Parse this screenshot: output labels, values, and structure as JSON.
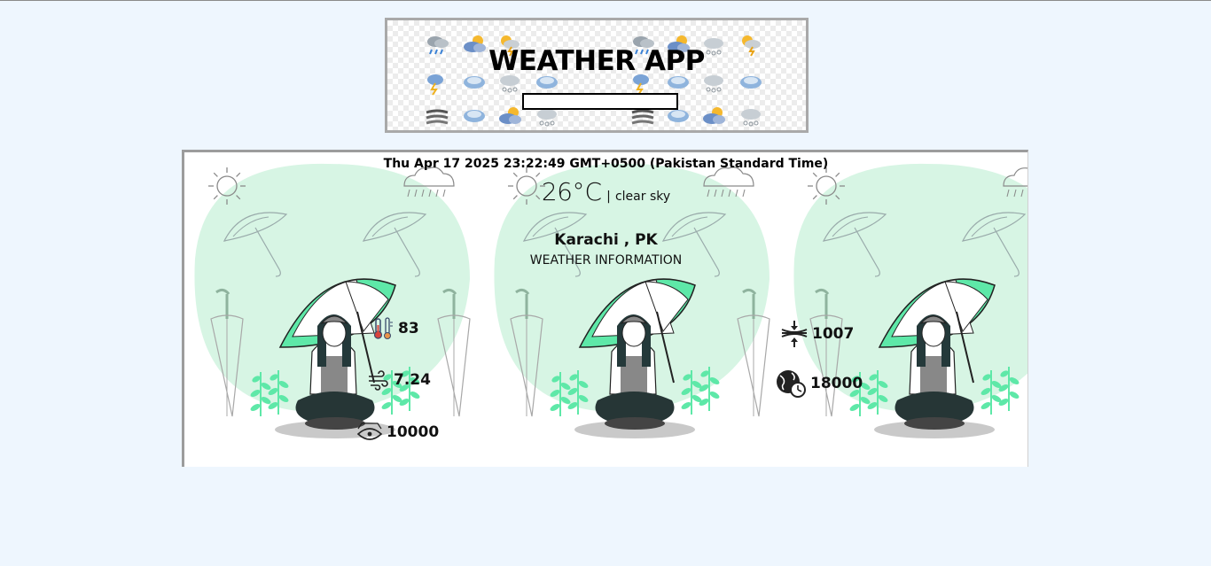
{
  "app": {
    "title": "WEATHER APP",
    "search": {
      "value": "",
      "placeholder": ""
    }
  },
  "weather": {
    "datetime": "Thu Apr 17 2025 23:22:49 GMT+0500 (Pakistan Standard Time)",
    "temperature": "26",
    "unit": "°C",
    "separator": "|",
    "description": "clear sky",
    "location": "Karachi , PK",
    "subtitle": "WEATHER INFORMATION",
    "stats": {
      "humidity": {
        "icon": "thermometer-humidity-icon",
        "value": "83"
      },
      "wind_speed": {
        "icon": "wind-icon",
        "value": "7.24"
      },
      "visibility": {
        "icon": "eye-icon",
        "value": "10000"
      },
      "pressure": {
        "icon": "pressure-icon",
        "value": "1007"
      },
      "timezone": {
        "icon": "globe-clock-icon",
        "value": "18000"
      }
    }
  },
  "colors": {
    "page_background": "#eef6fe",
    "illustration_green": "#5ee8a8",
    "illustration_blob": "#d7f5e4",
    "frame_border": "#9c9c9c"
  }
}
